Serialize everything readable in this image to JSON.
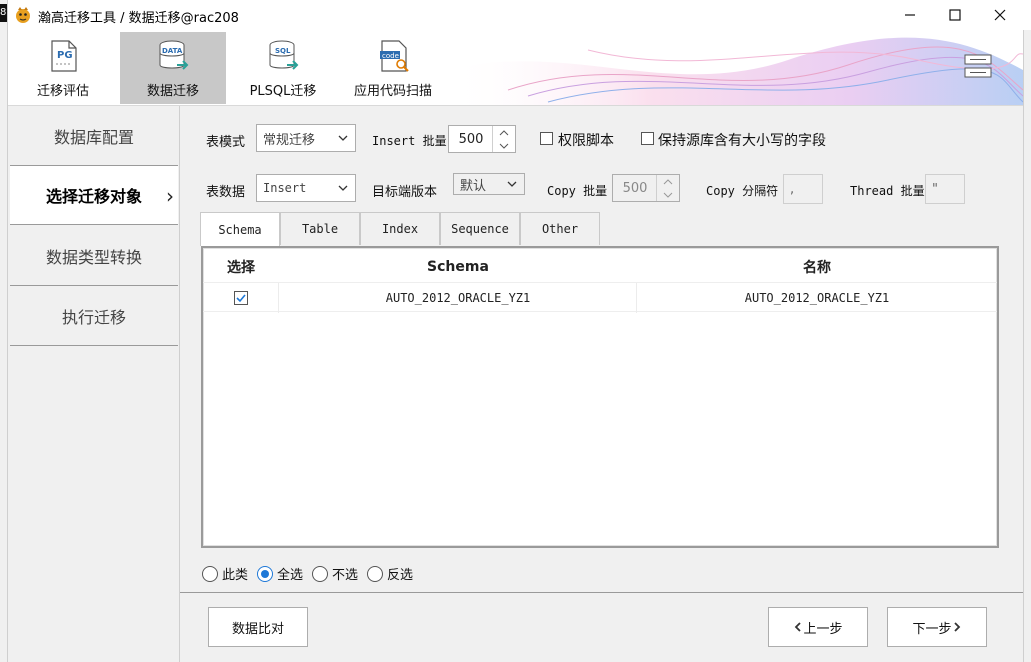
{
  "window": {
    "title": "瀚高迁移工具 / 数据迁移@rac208",
    "edge_badge": "8"
  },
  "toolbar": {
    "items": [
      {
        "label": "迁移评估",
        "icon": "pg-file-icon"
      },
      {
        "label": "数据迁移",
        "icon": "data-database-icon",
        "active": true
      },
      {
        "label": "PLSQL迁移",
        "icon": "sql-database-icon"
      },
      {
        "label": "应用代码扫描",
        "icon": "code-scan-icon"
      }
    ],
    "pg_text": "PG",
    "data_text": "DATA",
    "sql_text": "SQL",
    "code_text": "code"
  },
  "sidebar": {
    "items": [
      {
        "label": "数据库配置"
      },
      {
        "label": "选择迁移对象",
        "active": true
      },
      {
        "label": "数据类型转换"
      },
      {
        "label": "执行迁移"
      }
    ],
    "chevron": "›"
  },
  "options": {
    "table_mode_label": "表模式",
    "table_mode_value": "常规迁移",
    "insert_batch_label": "Insert 批量",
    "insert_batch_value": "500",
    "permission_script_label": "权限脚本",
    "keep_case_label": "保持源库含有大小写的字段",
    "table_data_label": "表数据",
    "table_data_value": "Insert",
    "target_version_label": "目标端版本",
    "target_version_value": "默认",
    "copy_batch_label": "Copy 批量",
    "copy_batch_value": "500",
    "copy_delim_label": "Copy 分隔符",
    "copy_delim_value": ",",
    "thread_batch_label": "Thread 批量",
    "thread_batch_value": "\""
  },
  "tabs": [
    {
      "label": "Schema",
      "active": true
    },
    {
      "label": "Table"
    },
    {
      "label": "Index"
    },
    {
      "label": "Sequence"
    },
    {
      "label": "Other"
    }
  ],
  "table": {
    "columns": [
      "选择",
      "Schema",
      "名称"
    ],
    "rows": [
      {
        "checked": true,
        "schema": "AUTO_2012_ORACLE_YZ1",
        "name": "AUTO_2012_ORACLE_YZ1"
      }
    ]
  },
  "selection": {
    "options": [
      {
        "label": "此类"
      },
      {
        "label": "全选",
        "selected": true
      },
      {
        "label": "不选"
      },
      {
        "label": "反选"
      }
    ]
  },
  "footer": {
    "compare_label": "数据比对",
    "prev_label": "上一步",
    "next_label": "下一步"
  },
  "colors": {
    "accent": "#1e78d7",
    "active_tool_bg": "#c8c8c8",
    "panel_bg": "#f0f0f0"
  }
}
